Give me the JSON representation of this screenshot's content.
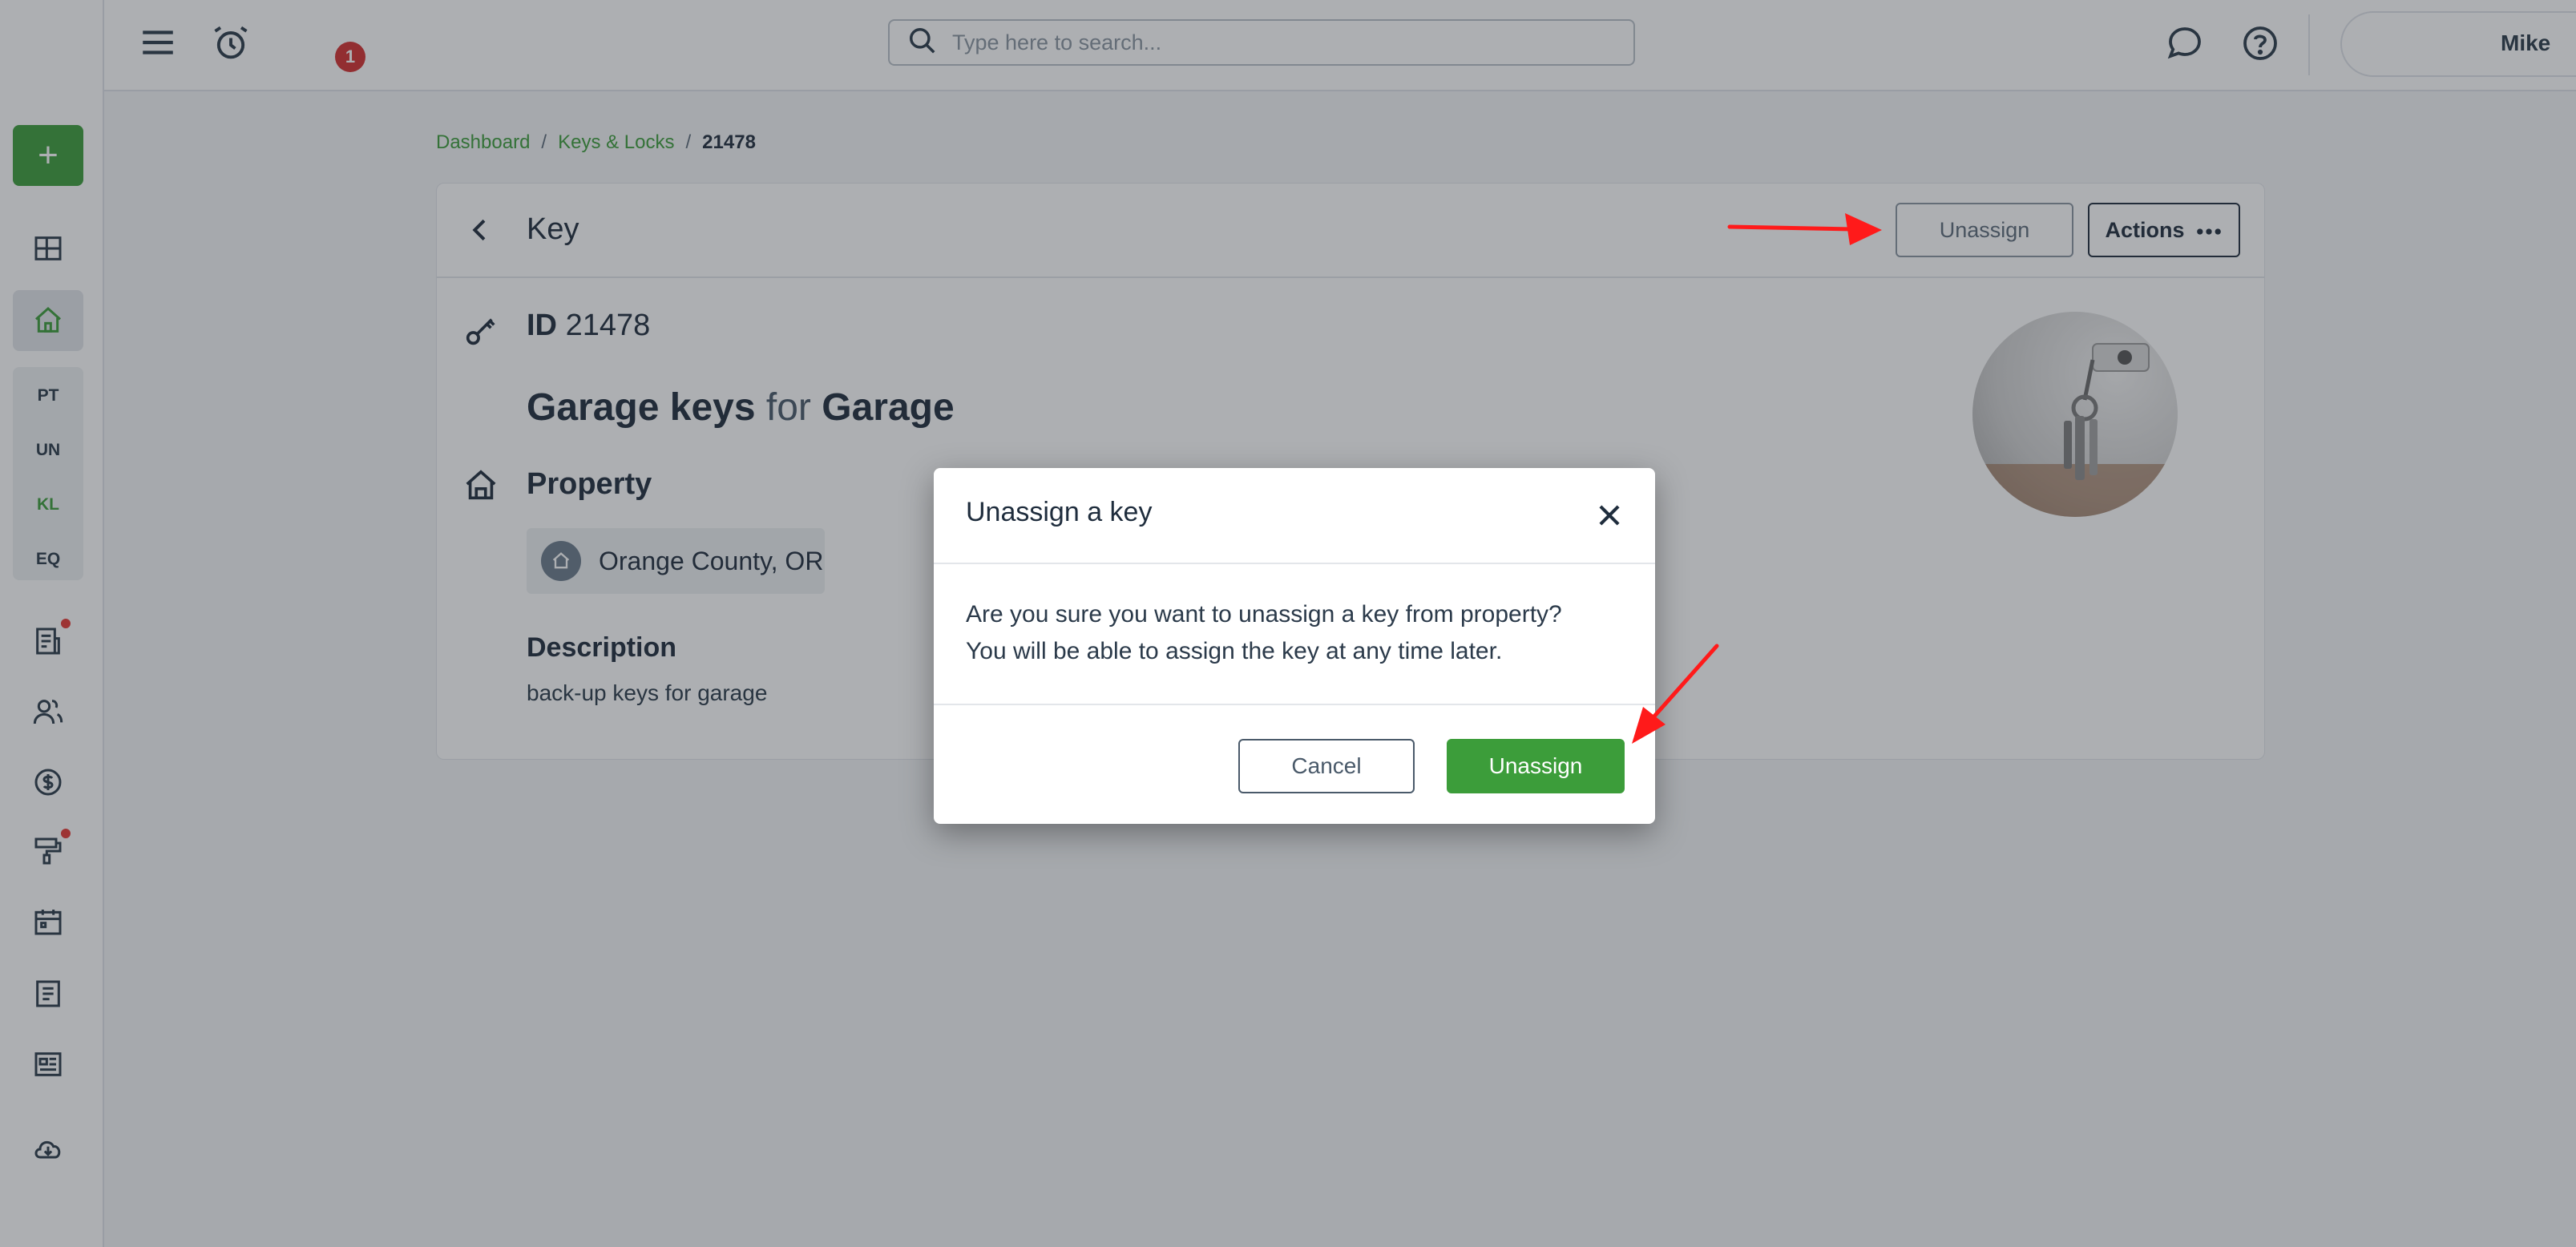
{
  "topbar": {
    "notifications_badge": "1",
    "search_placeholder": "Type here to search...",
    "user_name": "Mike"
  },
  "sidebar": {
    "add_label": "+",
    "group_items": [
      {
        "label": "PT"
      },
      {
        "label": "UN"
      },
      {
        "label": "KL"
      },
      {
        "label": "EQ"
      }
    ]
  },
  "breadcrumb": {
    "items": [
      "Dashboard",
      "Keys & Locks"
    ],
    "current": "21478",
    "separator": "/"
  },
  "card": {
    "title": "Key",
    "unassign_label": "Unassign",
    "actions_label": "Actions",
    "id_prefix": "ID",
    "id_value": "21478",
    "key_name": "Garage keys",
    "for_word": "for",
    "key_location": "Garage",
    "property_label": "Property",
    "property_value": "Orange County, OR",
    "description_label": "Description",
    "description_value": "back-up keys for garage"
  },
  "modal": {
    "title": "Unassign a key",
    "body_line1": "Are you sure you want to unassign a key from property?",
    "body_line2": "You will be able to assign the key at any time later.",
    "cancel_label": "Cancel",
    "confirm_label": "Unassign"
  },
  "colors": {
    "brand_green": "#3c9d3a",
    "annotation_red": "#ff1a1a",
    "badge_red": "#d32f2f"
  },
  "icons": [
    "menu-icon",
    "alarm-clock-icon",
    "search-icon",
    "chat-icon",
    "help-icon",
    "dashboard-grid-icon",
    "home-icon",
    "reports-icon",
    "users-icon",
    "dollar-icon",
    "paint-roller-icon",
    "calendar-icon",
    "document-icon",
    "news-icon",
    "cloud-download-icon",
    "chevron-left-icon",
    "key-icon",
    "property-icon",
    "more-dots-icon",
    "close-icon"
  ]
}
